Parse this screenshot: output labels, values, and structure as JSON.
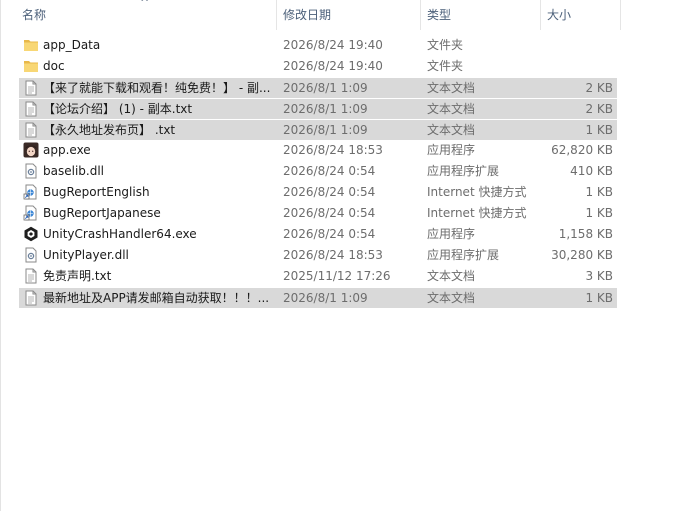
{
  "columns": {
    "name": "名称",
    "date": "修改日期",
    "type": "类型",
    "size": "大小",
    "sort_indicator": "^"
  },
  "files": [
    {
      "name": "app_Data",
      "date": "2026/8/24 19:40",
      "type": "文件夹",
      "size": "",
      "icon": "folder-icon",
      "selected": false
    },
    {
      "name": "doc",
      "date": "2026/8/24 19:40",
      "type": "文件夹",
      "size": "",
      "icon": "folder-icon",
      "selected": false
    },
    {
      "name": "【来了就能下载和观看！纯免费！】 - 副...",
      "date": "2026/8/1 1:09",
      "type": "文本文档",
      "size": "2 KB",
      "icon": "text-file-icon",
      "selected": true
    },
    {
      "name": "【论坛介绍】 (1) - 副本.txt",
      "date": "2026/8/1 1:09",
      "type": "文本文档",
      "size": "2 KB",
      "icon": "text-file-icon",
      "selected": true
    },
    {
      "name": "【永久地址发布页】 .txt",
      "date": "2026/8/1 1:09",
      "type": "文本文档",
      "size": "1 KB",
      "icon": "text-file-icon",
      "selected": true
    },
    {
      "name": "app.exe",
      "date": "2026/8/24 18:53",
      "type": "应用程序",
      "size": "62,820 KB",
      "icon": "app-avatar-icon",
      "selected": false
    },
    {
      "name": "baselib.dll",
      "date": "2026/8/24 0:54",
      "type": "应用程序扩展",
      "size": "410 KB",
      "icon": "dll-file-icon",
      "selected": false
    },
    {
      "name": "BugReportEnglish",
      "date": "2026/8/24 0:54",
      "type": "Internet 快捷方式",
      "size": "1 KB",
      "icon": "internet-shortcut-icon",
      "selected": false
    },
    {
      "name": "BugReportJapanese",
      "date": "2026/8/24 0:54",
      "type": "Internet 快捷方式",
      "size": "1 KB",
      "icon": "internet-shortcut-icon",
      "selected": false
    },
    {
      "name": "UnityCrashHandler64.exe",
      "date": "2026/8/24 0:54",
      "type": "应用程序",
      "size": "1,158 KB",
      "icon": "unity-icon",
      "selected": false
    },
    {
      "name": "UnityPlayer.dll",
      "date": "2026/8/24 18:53",
      "type": "应用程序扩展",
      "size": "30,280 KB",
      "icon": "dll-file-icon",
      "selected": false
    },
    {
      "name": "免责声明.txt",
      "date": "2025/11/12 17:26",
      "type": "文本文档",
      "size": "3 KB",
      "icon": "text-file-icon",
      "selected": false
    },
    {
      "name": "最新地址及APP请发邮箱自动获取！！！...",
      "date": "2026/8/1 1:09",
      "type": "文本文档",
      "size": "1 KB",
      "icon": "text-file-icon",
      "selected": true
    }
  ],
  "colors": {
    "header_text": "#4c607a",
    "selected_row": "#d9d9d9",
    "folder": "#f8d775"
  }
}
